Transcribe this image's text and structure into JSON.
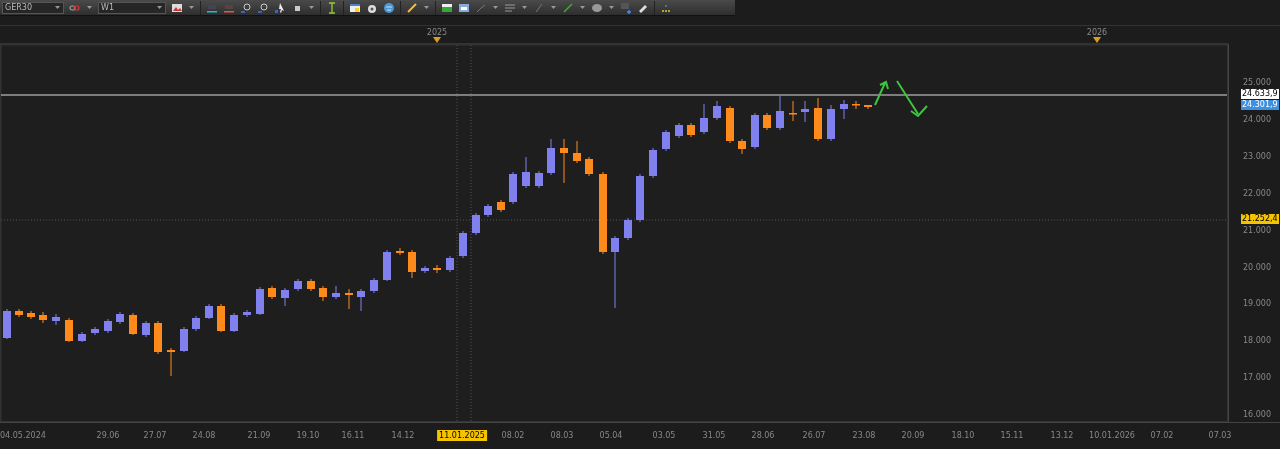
{
  "toolbar": {
    "symbol": "GER30",
    "timeframe": "W1"
  },
  "chart": {
    "year_labels": [
      "2025",
      "2026"
    ],
    "price_labels": [
      "25.000",
      "24.000",
      "23.000",
      "22.000",
      "21.000",
      "20.000",
      "19.000",
      "18.000",
      "17.000",
      "16.000"
    ],
    "price_markers": [
      {
        "kind": "line",
        "text": "24.633,9"
      },
      {
        "kind": "bid",
        "text": "24.301,9"
      },
      {
        "kind": "crosshair",
        "text": "21.252,4"
      }
    ],
    "date_labels": [
      {
        "text": "04.05.2024",
        "selected": false
      },
      {
        "text": "29.06",
        "selected": false
      },
      {
        "text": "27.07",
        "selected": false
      },
      {
        "text": "24.08",
        "selected": false
      },
      {
        "text": "21.09",
        "selected": false
      },
      {
        "text": "19.10",
        "selected": false
      },
      {
        "text": "16.11",
        "selected": false
      },
      {
        "text": "14.12",
        "selected": false
      },
      {
        "text": "11.01.2025",
        "selected": true
      },
      {
        "text": "08.02",
        "selected": false
      },
      {
        "text": "08.03",
        "selected": false
      },
      {
        "text": "05.04",
        "selected": false
      },
      {
        "text": "03.05",
        "selected": false
      },
      {
        "text": "31.05",
        "selected": false
      },
      {
        "text": "28.06",
        "selected": false
      },
      {
        "text": "26.07",
        "selected": false
      },
      {
        "text": "23.08",
        "selected": false
      },
      {
        "text": "20.09",
        "selected": false
      },
      {
        "text": "18.10",
        "selected": false
      },
      {
        "text": "15.11",
        "selected": false
      },
      {
        "text": "13.12",
        "selected": false
      },
      {
        "text": "10.01.2026",
        "selected": false
      },
      {
        "text": "07.02",
        "selected": false
      },
      {
        "text": "07.03",
        "selected": false
      }
    ]
  }
}
